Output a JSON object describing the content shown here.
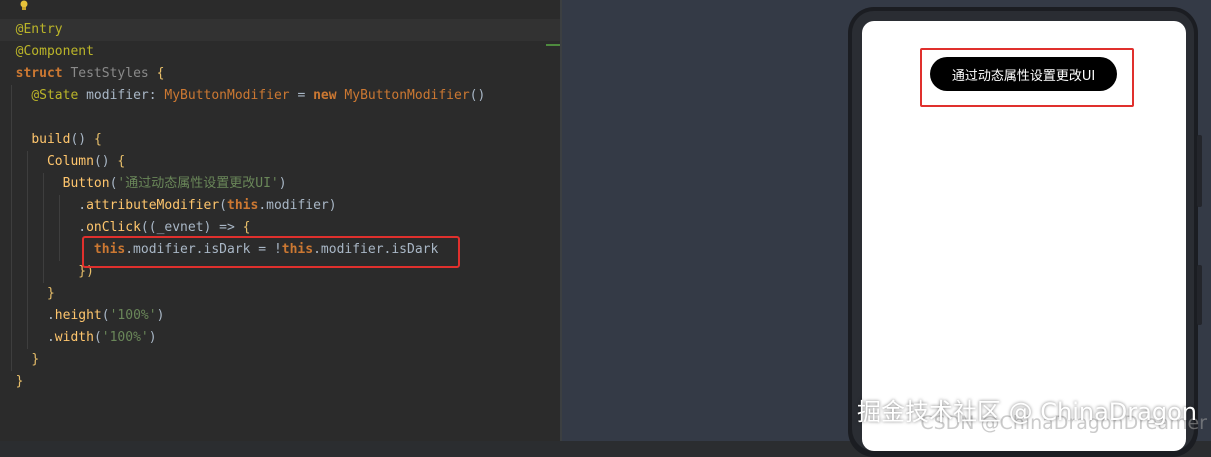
{
  "code": {
    "l1": {
      "ann": "@Entry"
    },
    "l2": {
      "ann": "@Component"
    },
    "l3": {
      "kw": "struct",
      "name": "TestStyles",
      "brace": "{"
    },
    "l4": {
      "ann": "@State",
      "id": "modifier:",
      "type": "MyButtonModifier",
      "eq": "=",
      "kw": "new",
      "call": "MyButtonModifier",
      "paren": "()"
    },
    "l6": {
      "fn": "build",
      "paren": "()",
      "brace": "{"
    },
    "l7": {
      "fn": "Column",
      "paren": "()",
      "brace": "{"
    },
    "l8": {
      "fn": "Button",
      "open": "(",
      "str": "'通过动态属性设置更改UI'",
      "close": ")"
    },
    "l9": {
      "dot": ".",
      "fn": "attributeModifier",
      "open": "(",
      "this": "this",
      "rest": ".modifier",
      "close": ")"
    },
    "l10": {
      "dot": ".",
      "fn": "onClick",
      "open": "((",
      "param": "_evnet",
      "arrow": ") =>",
      "brace": "{"
    },
    "l11": {
      "this1": "this",
      "mid": ".modifier.isDark = !",
      "this2": "this",
      "end": ".modifier.isDark"
    },
    "l12": {
      "close": "})"
    },
    "l13": {
      "close": "}"
    },
    "l14": {
      "dot": ".",
      "fn": "height",
      "open": "(",
      "str": "'100%'",
      "close": ")"
    },
    "l15": {
      "dot": ".",
      "fn": "width",
      "open": "(",
      "str": "'100%'",
      "close": ")"
    },
    "l16": {
      "close": "}"
    },
    "l17": {
      "close": "}"
    }
  },
  "preview": {
    "button_label": "通过动态属性设置更改UI"
  },
  "watermark": {
    "text": "掘金技术社区 @ ChinaDragon",
    "subtext": "CSDN @ChinaDragonDreamer"
  },
  "colors": {
    "highlight": "#e0302d",
    "editor_bg": "#2b2b2b",
    "preview_bg": "#343a46"
  }
}
